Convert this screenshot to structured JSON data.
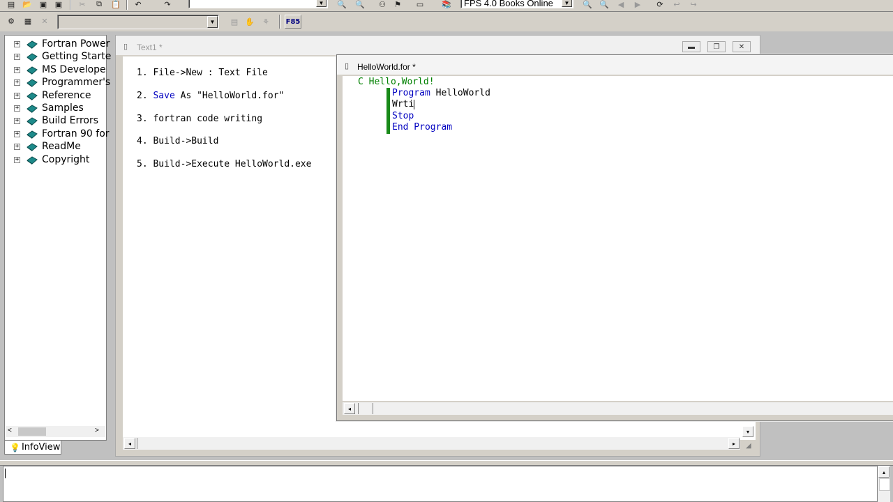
{
  "toolbar1": {
    "search_combo_value": "",
    "books_combo_value": "FPS 4.0 Books Online"
  },
  "toolbar2": {
    "config_combo_value": "",
    "f85_label": "F85"
  },
  "infoview": {
    "tab_label": "InfoView",
    "items": [
      {
        "label": "Fortran Power"
      },
      {
        "label": "Getting Starte"
      },
      {
        "label": "MS Develope"
      },
      {
        "label": "Programmer's"
      },
      {
        "label": "Reference"
      },
      {
        "label": "Samples"
      },
      {
        "label": "Build Errors"
      },
      {
        "label": "Fortran 90 for"
      },
      {
        "label": "ReadMe"
      },
      {
        "label": "Copyright"
      }
    ]
  },
  "text1_window": {
    "title": "Text1 *",
    "steps": [
      {
        "num": "1.",
        "pre": "",
        "kw": "",
        "text": "File->New : Text File"
      },
      {
        "num": "2.",
        "pre": "",
        "kw": "Save",
        "text": " As \"HelloWorld.for\""
      },
      {
        "num": "3.",
        "pre": "",
        "kw": "",
        "text": "fortran code writing"
      },
      {
        "num": "4.",
        "pre": "",
        "kw": "",
        "text": "Build->Build"
      },
      {
        "num": "5.",
        "pre": "",
        "kw": "",
        "text": "Build->Execute HelloWorld.exe"
      }
    ]
  },
  "helloworld_window": {
    "title": "HelloWorld.for *",
    "code": {
      "comment": "C Hello,World!",
      "line2_kw": "Program",
      "line2_rest": " HelloWorld",
      "line3": "Wrti",
      "line4_kw": "Stop",
      "line5_kw": "End Program"
    }
  },
  "colors": {
    "keyword": "#0000c0",
    "comment": "#008000",
    "gutter_marker": "#1a8a1a"
  }
}
